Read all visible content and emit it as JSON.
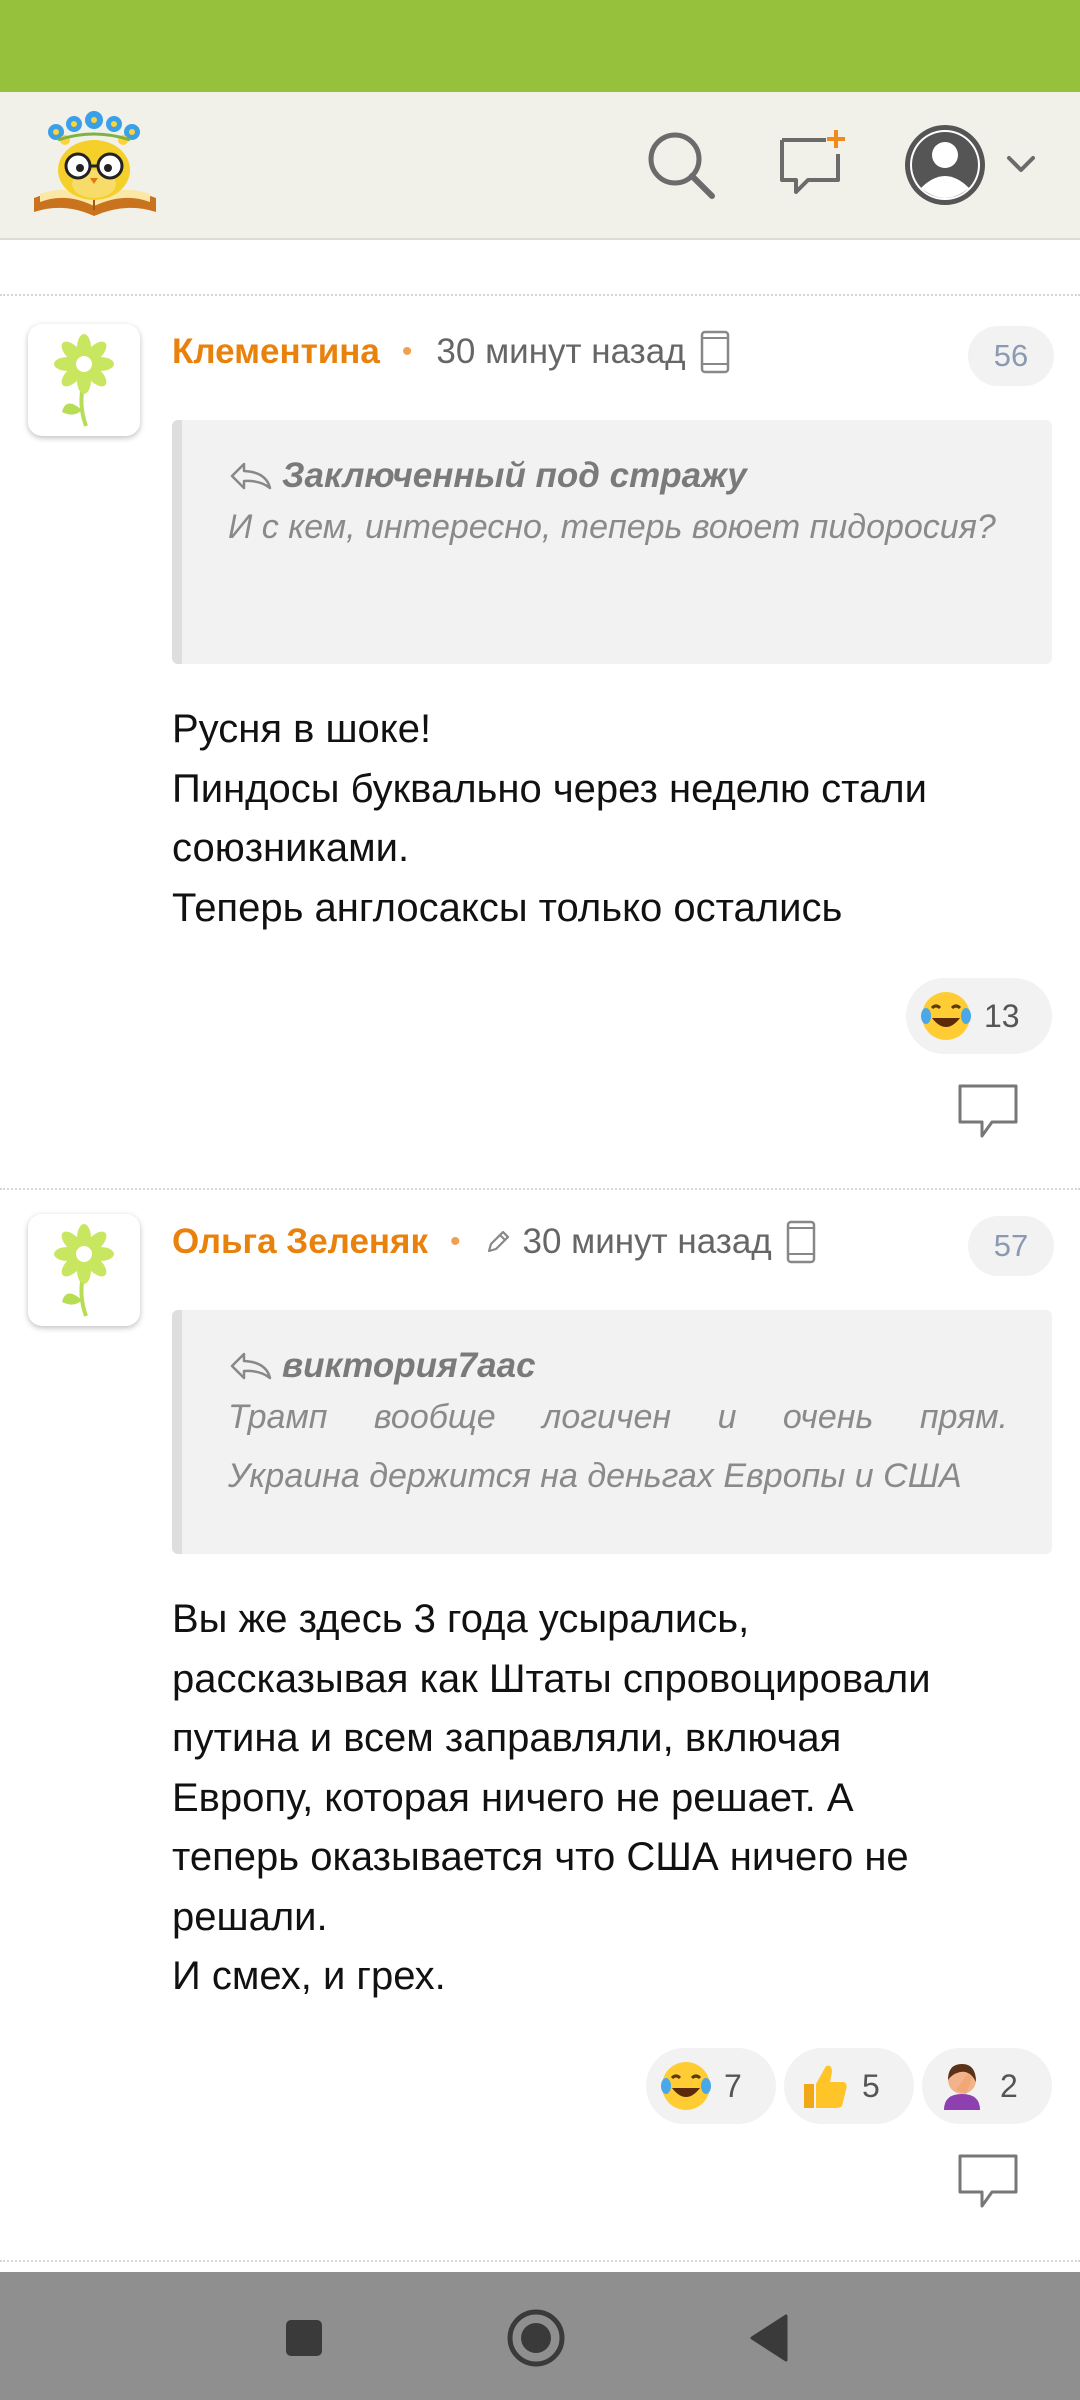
{
  "header": {
    "logo_icon": "owl-with-flowers-on-book-logo",
    "search_icon": "search-icon",
    "compose_icon": "new-message-icon",
    "profile_icon": "user-avatar-icon"
  },
  "comments": [
    {
      "author": "Клементина",
      "time": "30 минут назад",
      "edited": false,
      "number": "56",
      "quote_author": "Заключенный под стражу",
      "quote_text": "И с кем, интересно, теперь воюет пидоросия?",
      "body_lines": [
        "Русня в шоке!",
        "Пиндосы буквально через неделю стали",
        "союзниками.",
        "Теперь англосаксы только остались"
      ],
      "reactions": [
        {
          "icon": "laughing-tears-emoji",
          "count": "13"
        }
      ]
    },
    {
      "author": "Ольга Зеленяк",
      "time": "30 минут назад",
      "edited": true,
      "number": "57",
      "quote_author": "виктория7аас",
      "quote_line1": "Трамп вообще логичен и очень прям.",
      "quote_line2": "Украина держится на деньгах Европы и США",
      "body_lines": [
        "Вы же здесь 3 года усырались,",
        "рассказывая как Штаты спровоцировали",
        "путина и всем заправляли, включая",
        "Европу, которая ничего не решает. А",
        "теперь оказывается что США ничего не",
        "решали.",
        "И смех, и грех."
      ],
      "reactions": [
        {
          "icon": "laughing-tears-emoji",
          "count": "7"
        },
        {
          "icon": "thumbs-up-emoji",
          "count": "5"
        },
        {
          "icon": "facepalm-emoji",
          "count": "2"
        }
      ]
    }
  ],
  "navigation": {
    "recents_icon": "square-recents-icon",
    "home_icon": "circle-home-icon",
    "back_icon": "triangle-back-icon"
  },
  "colors": {
    "status_bar": "#95c13d",
    "header_bg": "#f1f1ea",
    "author": "#e8820c",
    "quote_bg": "#f2f2f2",
    "nav_bar": "#8f8f8f"
  }
}
